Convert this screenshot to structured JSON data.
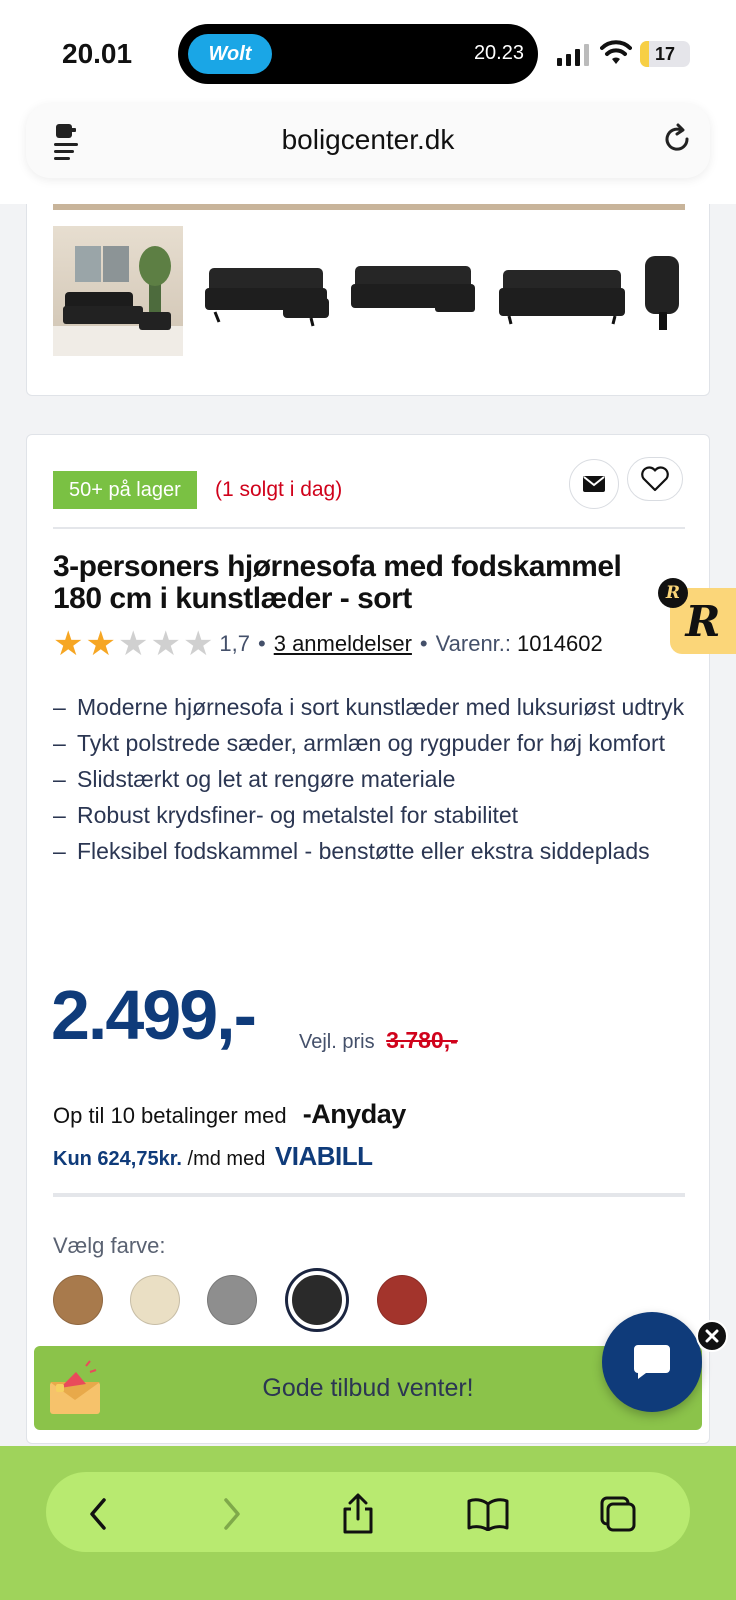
{
  "status_bar": {
    "time": "20.01",
    "island_app": "Wolt",
    "island_time": "20.23",
    "battery": "17",
    "battery_level": 0.17
  },
  "browser": {
    "url": "boligcenter.dk"
  },
  "product": {
    "stock_badge": "50+ på lager",
    "sold_today": "(1 solgt i dag)",
    "title": "3-personers hjørnesofa med fodskammel 180 cm i kunstlæder - sort",
    "rating_value": "1,7",
    "rating_stars": 2,
    "rating_max": 5,
    "reviews_link": "3 anmeldelser",
    "sku_label": "Varenr.:",
    "sku": "1014602",
    "bullets": [
      "Moderne hjørnesofa i sort kunstlæder med luksuriøst udtryk",
      "Tykt polstrede sæder, armlæn og rygpuder for høj komfort",
      "Slidstærkt og let at rengøre materiale",
      "Robust krydsfiner- og metalstel for stabilitet",
      "Fleksibel fodskammel - benstøtte eller ekstra siddeplads"
    ],
    "price": "2.499,-",
    "vejl_label": "Vejl. pris",
    "old_price": "3.780,-",
    "anyday_text": "Op til 10 betalinger med",
    "anyday_logo": "-Anyday",
    "viabill_kun": "Kun 624,75kr.",
    "viabill_text": "/md med",
    "viabill_logo": "VIABILL",
    "color_label": "Vælg farve:",
    "colors": [
      "#a87a4c",
      "#eadfc4",
      "#8e8e8e",
      "#2a2a2a",
      "#a3342c"
    ],
    "selected_color_index": 3
  },
  "offers_banner": "Gode tilbud venter!",
  "badge": {
    "big": "R",
    "small": "R"
  }
}
